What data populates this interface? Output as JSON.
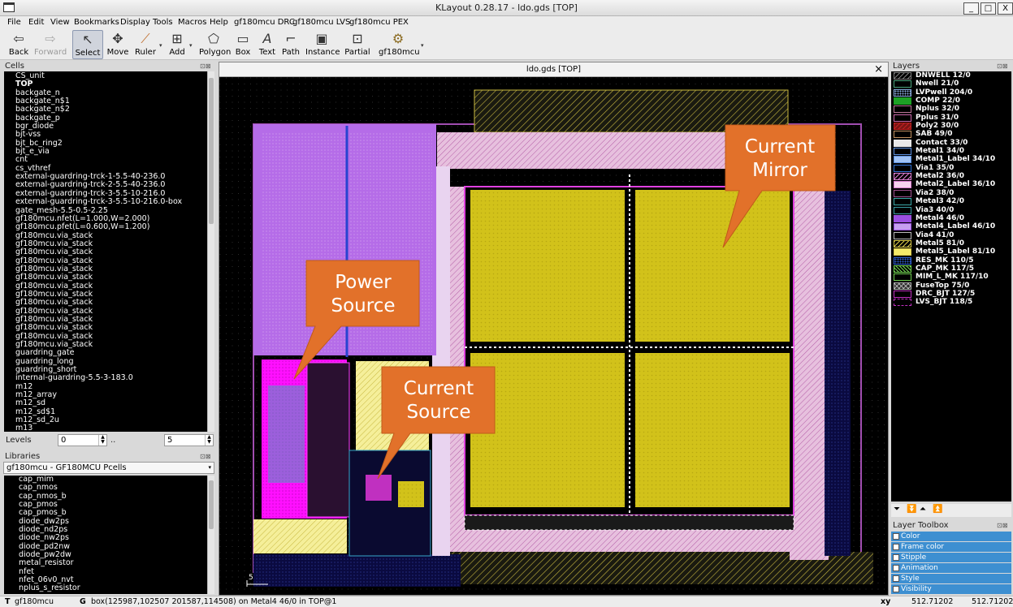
{
  "window": {
    "title": "KLayout 0.28.17 - ldo.gds [TOP]",
    "controls": [
      "_",
      "□",
      "X"
    ]
  },
  "menu": [
    "File",
    "Edit",
    "View",
    "Bookmarks",
    "Display",
    "Tools",
    "Macros",
    "Help",
    "gf180mcu DRC",
    "gf180mcu LVS",
    "gf180mcu PEX"
  ],
  "toolbar": {
    "back": "Back",
    "forward": "Forward",
    "select": "Select",
    "move": "Move",
    "ruler": "Ruler",
    "add": "Add",
    "polygon": "Polygon",
    "box": "Box",
    "text": "Text",
    "path": "Path",
    "instance": "Instance",
    "partial": "Partial",
    "pdk": "gf180mcu"
  },
  "cells_panel": {
    "title": "Cells",
    "items": [
      "CS_unit",
      "TOP",
      "backgate_n",
      "backgate_n$1",
      "backgate_n$2",
      "backgate_p",
      "bgr_diode",
      "bjt-vss",
      "bjt_bc_ring2",
      "bjt_e_via",
      "cnt",
      "cs_vthref",
      "external-guardring-trck-1-5.5-40-236.0",
      "external-guardring-trck-2-5.5-40-236.0",
      "external-guardring-trck-3-5.5-10-216.0",
      "external-guardring-trck-3-5.5-10-216.0-box",
      "gate_mesh-5.5-0.5-2.25",
      "gf180mcu.nfet(L=1.000,W=2.000)",
      "gf180mcu.pfet(L=0.600,W=1.200)",
      "gf180mcu.via_stack",
      "gf180mcu.via_stack",
      "gf180mcu.via_stack",
      "gf180mcu.via_stack",
      "gf180mcu.via_stack",
      "gf180mcu.via_stack",
      "gf180mcu.via_stack",
      "gf180mcu.via_stack",
      "gf180mcu.via_stack",
      "gf180mcu.via_stack",
      "gf180mcu.via_stack",
      "gf180mcu.via_stack",
      "gf180mcu.via_stack",
      "gf180mcu.via_stack",
      "guardring_gate",
      "guardring_long",
      "guardring_short",
      "internal-guardring-5.5-3-183.0",
      "m12",
      "m12_array",
      "m12_sd",
      "m12_sd$1",
      "m12_sd_2u",
      "m13"
    ],
    "levels_label": "Levels",
    "level_from": "0",
    "level_sep": "..",
    "level_to": "5"
  },
  "libraries_panel": {
    "title": "Libraries",
    "selected": "gf180mcu - GF180MCU Pcells",
    "items": [
      "cap_mim",
      "cap_nmos",
      "cap_nmos_b",
      "cap_pmos",
      "cap_pmos_b",
      "diode_dw2ps",
      "diode_nd2ps",
      "diode_nw2ps",
      "diode_pd2nw",
      "diode_pw2dw",
      "metal_resistor",
      "nfet",
      "nfet_06v0_nvt",
      "nplus_s_resistor"
    ]
  },
  "layout_view": {
    "title": "ldo.gds [TOP]",
    "close": "×",
    "annotations": {
      "current_mirror": [
        "Current",
        "Mirror"
      ],
      "power_source": [
        "Power",
        "Source"
      ],
      "current_source": [
        "Current",
        "Source"
      ]
    },
    "scale_label": "5"
  },
  "layers_panel": {
    "title": "Layers",
    "layers": [
      {
        "name": "DNWELL 12/0",
        "color": "#000000",
        "pattern": "diag",
        "stroke": "#7a7a7a"
      },
      {
        "name": "Nwell 21/0",
        "color": "#000000",
        "pattern": "none",
        "stroke": "#4aa37c"
      },
      {
        "name": "LVPwell 204/0",
        "color": "#000000",
        "pattern": "dots",
        "stroke": "#88aadd"
      },
      {
        "name": "COMP 22/0",
        "color": "#1da125",
        "pattern": "solid",
        "stroke": "#1da125"
      },
      {
        "name": "Nplus 32/0",
        "color": "#000000",
        "pattern": "none",
        "stroke": "#bb7799"
      },
      {
        "name": "Pplus 31/0",
        "color": "#000000",
        "pattern": "none",
        "stroke": "#cc66aa"
      },
      {
        "name": "Poly2 30/0",
        "color": "#7a1515",
        "pattern": "diag",
        "stroke": "#c02020"
      },
      {
        "name": "SAB 49/0",
        "color": "#000000",
        "pattern": "none",
        "stroke": "#c09060"
      },
      {
        "name": "Contact 33/0",
        "color": "#e8e8e8",
        "pattern": "solid",
        "stroke": "#e8e8e8"
      },
      {
        "name": "Metal1 34/0",
        "color": "#000000",
        "pattern": "none",
        "stroke": "#5a8fe0"
      },
      {
        "name": "Metal1_Label 34/10",
        "color": "#9fc2f5",
        "pattern": "solid",
        "stroke": "#5a8fe0"
      },
      {
        "name": "Via1 35/0",
        "color": "#000000",
        "pattern": "none",
        "stroke": "#2e6fd0"
      },
      {
        "name": "Metal2 36/0",
        "color": "#000000",
        "pattern": "diag",
        "stroke": "#d87acd"
      },
      {
        "name": "Metal2_Label 36/10",
        "color": "#f6d2ee",
        "pattern": "solid",
        "stroke": "#d87acd"
      },
      {
        "name": "Via2 38/0",
        "color": "#000000",
        "pattern": "none",
        "stroke": "#a05090"
      },
      {
        "name": "Metal3 42/0",
        "color": "#000000",
        "pattern": "none",
        "stroke": "#3aa5a5"
      },
      {
        "name": "Via3 40/0",
        "color": "#000000",
        "pattern": "none",
        "stroke": "#3a9aa0"
      },
      {
        "name": "Metal4 46/0",
        "color": "#9a4fe0",
        "pattern": "dots",
        "stroke": "#9a4fe0"
      },
      {
        "name": "Metal4_Label 46/10",
        "color": "#c69ff0",
        "pattern": "solid",
        "stroke": "#9a4fe0"
      },
      {
        "name": "Via4 41/0",
        "color": "#000000",
        "pattern": "none",
        "stroke": "#bbbbbb"
      },
      {
        "name": "Metal5 81/0",
        "color": "#000000",
        "pattern": "diag",
        "stroke": "#d8c84a"
      },
      {
        "name": "Metal5_Label 81/10",
        "color": "#f5ea6a",
        "pattern": "solid",
        "stroke": "#d8c84a"
      },
      {
        "name": "RES_MK 110/5",
        "color": "#000000",
        "pattern": "dots",
        "stroke": "#3060d0"
      },
      {
        "name": "CAP_MK 117/5",
        "color": "#000000",
        "pattern": "wave",
        "stroke": "#70d050"
      },
      {
        "name": "MIM_L_MK 117/10",
        "color": "#000000",
        "pattern": "none",
        "stroke": "#70d050"
      },
      {
        "name": "FuseTop 75/0",
        "color": "#2a2a2a",
        "pattern": "cross",
        "stroke": "#aaaaaa"
      },
      {
        "name": "DRC_BJT 127/5",
        "color": "#000000",
        "pattern": "none",
        "stroke": "#c030c0"
      },
      {
        "name": "LVS_BJT 118/5",
        "color": "#000000",
        "pattern": "dash",
        "stroke": "#c030c0"
      }
    ]
  },
  "layer_toolbox": {
    "title": "Layer Toolbox",
    "items": [
      "Color",
      "Frame color",
      "Stipple",
      "Animation",
      "Style",
      "Visibility"
    ]
  },
  "statusbar": {
    "mode": "T",
    "library": "gf180mcu",
    "g": "G",
    "message": "box(125987,102507 201587,114508) on Metal4 46/0 in TOP@1",
    "coord_label": "xy",
    "x": "512.71202",
    "y": "512.71202"
  },
  "colors": {
    "metal5_yellow": "#d2c21a",
    "metal2_pink": "#e7c0de",
    "metal4_purple": "#b56ce8",
    "magenta": "#ff10ff",
    "callout_orange": "#e2712a",
    "toolbox_blue": "#3d8fd1"
  }
}
